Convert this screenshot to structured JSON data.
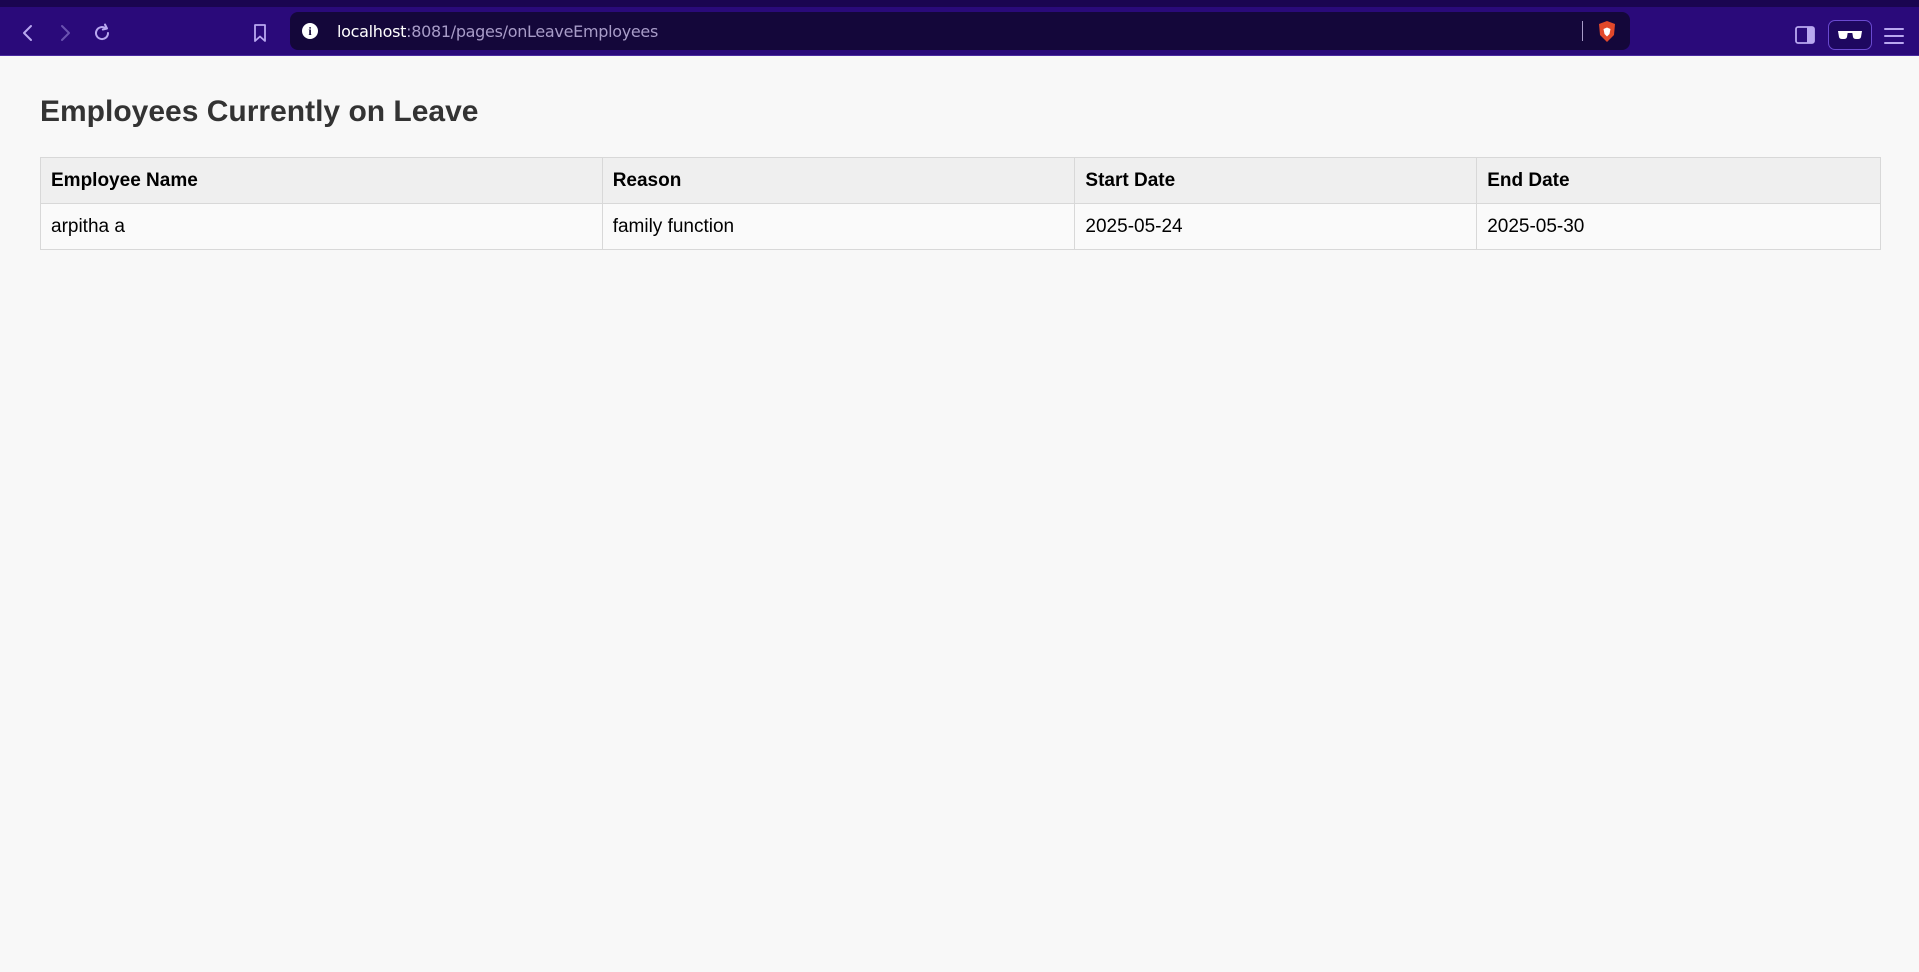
{
  "browser": {
    "url_host": "localhost",
    "url_rest": ":8081/pages/onLeaveEmployees",
    "icons": {
      "back": "chevron-left-icon",
      "forward": "chevron-right-icon",
      "reload": "reload-icon",
      "bookmark": "bookmark-icon",
      "site_info": "info-icon",
      "shields": "brave-shield-icon",
      "sidebar": "sidebar-icon",
      "private": "glasses-icon",
      "menu": "hamburger-menu-icon"
    },
    "colors": {
      "toolbar": "#2a0a7a",
      "urlbar": "#14073a",
      "shield": "#e2482a"
    }
  },
  "page": {
    "title": "Employees Currently on Leave",
    "table": {
      "headers": [
        "Employee Name",
        "Reason",
        "Start Date",
        "End Date"
      ],
      "rows": [
        [
          "arpitha a",
          "family function",
          "2025-05-24",
          "2025-05-30"
        ]
      ]
    }
  }
}
